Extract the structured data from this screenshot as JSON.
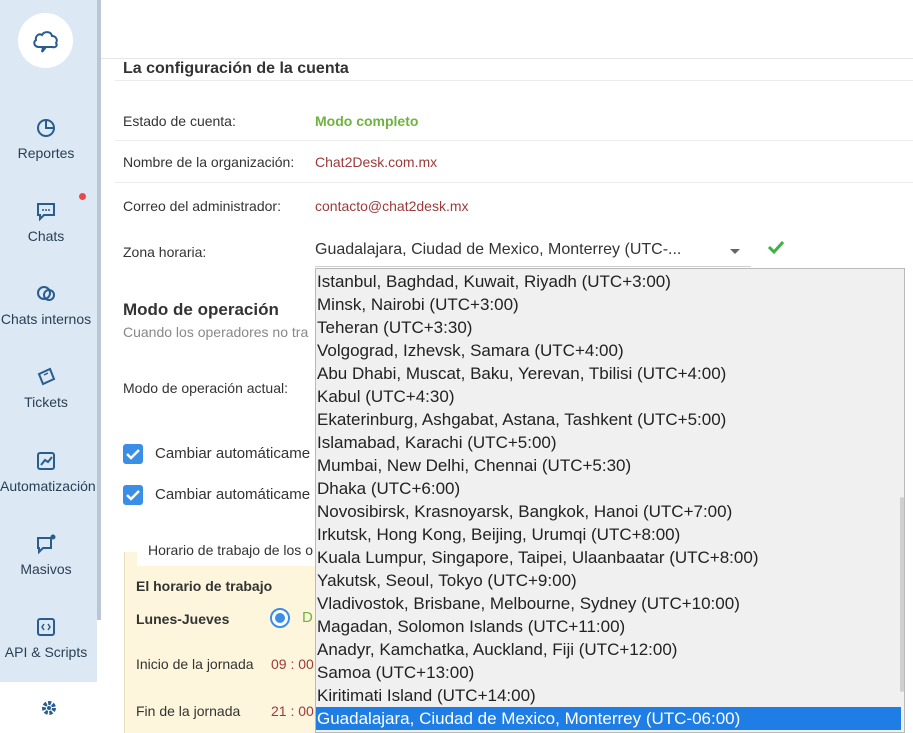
{
  "sidebar": {
    "items": [
      {
        "label": "Reportes",
        "icon": "pie-chart-icon"
      },
      {
        "label": "Chats",
        "icon": "chat-bubble-icon"
      },
      {
        "label": "Chats internos",
        "icon": "internal-chat-icon"
      },
      {
        "label": "Tickets",
        "icon": "ticket-icon"
      },
      {
        "label": "Automatización",
        "icon": "automation-chart-icon"
      },
      {
        "label": "Masivos",
        "icon": "broadcast-icon"
      },
      {
        "label": "API & Scripts",
        "icon": "code-icon"
      }
    ],
    "settings_icon": "gear-icon",
    "accent": "#dce8f3"
  },
  "account": {
    "title": "La configuración de la cuenta",
    "status_label": "Estado de cuenta:",
    "status_value": "Modo completo",
    "org_label": "Nombre de la organización:",
    "org_value": "Chat2Desk.com.mx",
    "email_label": "Correo del administrador:",
    "email_value": "contacto@chat2desk.mx",
    "tz_label": "Zona horaria:",
    "tz_value": "Guadalajara, Ciudad de Mexico, Monterrey (UTC-..."
  },
  "operation": {
    "title": "Modo de operación",
    "desc": "Cuando los operadores no tra",
    "current_label": "Modo de operación actual:",
    "auto1": "Cambiar automáticame",
    "auto2": "Cambiar automáticame"
  },
  "schedule": {
    "legend": "Horario de trabajo de los o",
    "heading": "El horario de trabajo",
    "days": "Lunes-Jueves",
    "radio_text": "D",
    "start_label": "Inicio de la jornada",
    "start_value": "09 : 00",
    "end_label": "Fin de la jornada",
    "end_value": "21 : 00"
  },
  "timezone_options": [
    "Istanbul, Baghdad, Kuwait, Riyadh (UTC+3:00)",
    "Minsk, Nairobi (UTC+3:00)",
    "Teheran (UTC+3:30)",
    "Volgograd, Izhevsk, Samara (UTC+4:00)",
    "Abu Dhabi, Muscat, Baku, Yerevan, Tbilisi (UTC+4:00)",
    "Kabul (UTC+4:30)",
    "Ekaterinburg, Ashgabat, Astana, Tashkent (UTC+5:00)",
    "Islamabad, Karachi (UTC+5:00)",
    "Mumbai, New Delhi, Chennai (UTC+5:30)",
    "Dhaka (UTC+6:00)",
    "Novosibirsk, Krasnoyarsk, Bangkok, Hanoi (UTC+7:00)",
    "Irkutsk, Hong Kong, Beijing, Urumqi (UTC+8:00)",
    "Kuala Lumpur, Singapore, Taipei, Ulaanbaatar (UTC+8:00)",
    "Yakutsk, Seoul, Tokyo (UTC+9:00)",
    "Vladivostok, Brisbane, Melbourne, Sydney (UTC+10:00)",
    "Magadan, Solomon Islands (UTC+11:00)",
    "Anadyr, Kamchatka, Auckland, Fiji (UTC+12:00)",
    "Samoa (UTC+13:00)",
    "Kiritimati Island (UTC+14:00)",
    "Guadalajara, Ciudad de Mexico, Monterrey (UTC-06:00)"
  ],
  "selected_timezone_index": 19,
  "colors": {
    "green": "#6fb33f",
    "link_red": "#9b3a3a",
    "primary": "#3a8ee6",
    "selected": "#1e7ee6"
  }
}
